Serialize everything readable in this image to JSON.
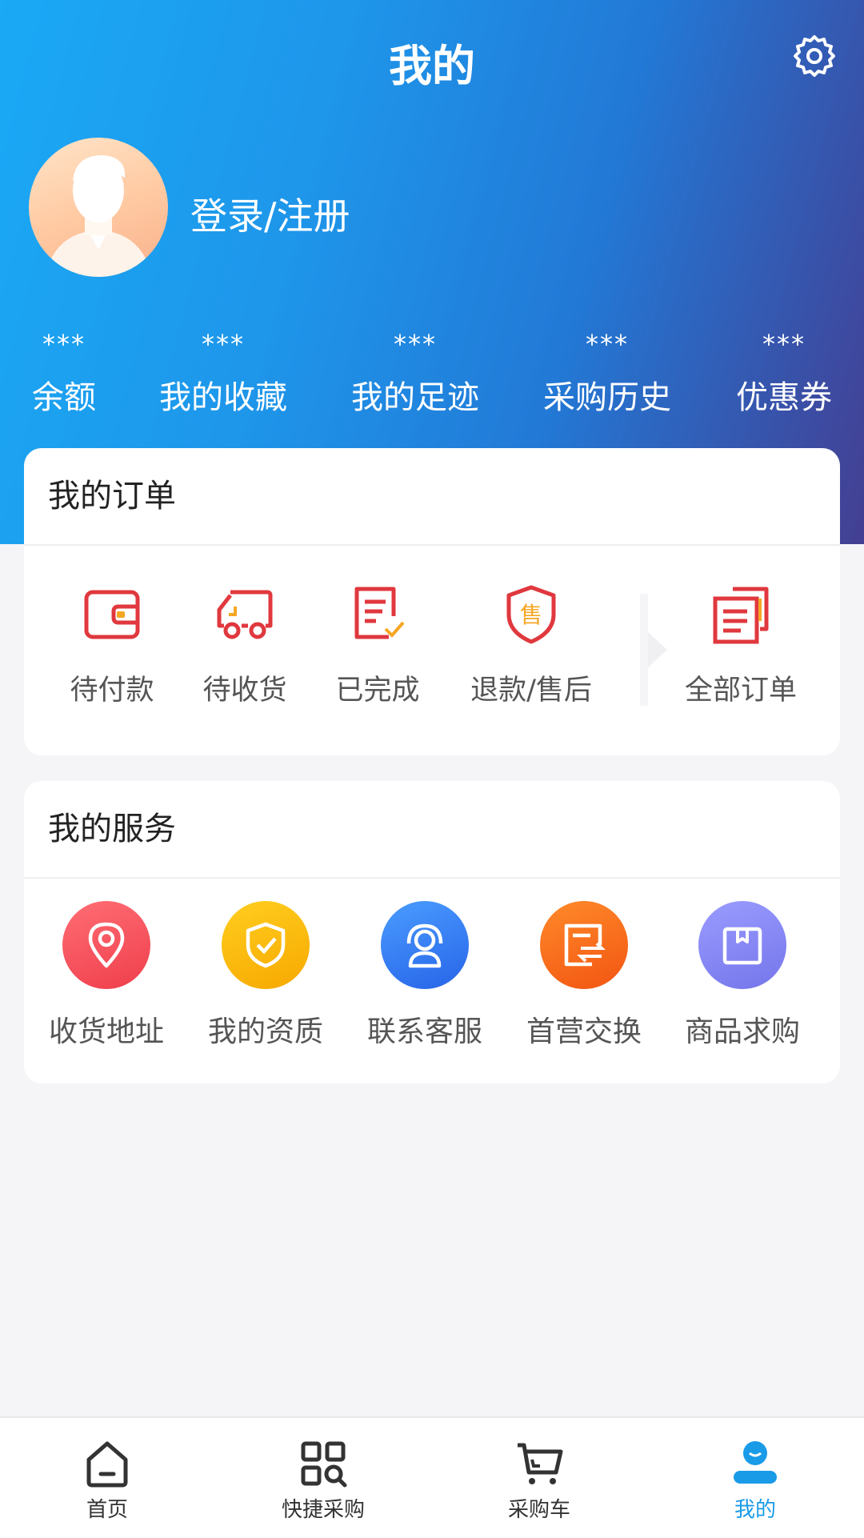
{
  "header": {
    "title": "我的",
    "settings_icon": "gear-icon"
  },
  "profile": {
    "login_label": "登录/注册",
    "avatar_icon": "default-avatar"
  },
  "stats": [
    {
      "value": "***",
      "label": "余额"
    },
    {
      "value": "***",
      "label": "我的收藏"
    },
    {
      "value": "***",
      "label": "我的足迹"
    },
    {
      "value": "***",
      "label": "采购历史"
    },
    {
      "value": "***",
      "label": "优惠券"
    }
  ],
  "orders": {
    "title": "我的订单",
    "items": [
      {
        "label": "待付款",
        "icon": "wallet-icon"
      },
      {
        "label": "待收货",
        "icon": "truck-icon"
      },
      {
        "label": "已完成",
        "icon": "document-check-icon"
      },
      {
        "label": "退款/售后",
        "icon": "shield-sale-icon"
      },
      {
        "label": "全部订单",
        "icon": "documents-icon"
      }
    ]
  },
  "services": {
    "title": "我的服务",
    "items": [
      {
        "label": "收货地址",
        "icon": "location-pin-icon",
        "color": "#f5545f"
      },
      {
        "label": "我的资质",
        "icon": "shield-check-icon",
        "color": "#f7b500"
      },
      {
        "label": "联系客服",
        "icon": "customer-service-icon",
        "color": "#2f7af2"
      },
      {
        "label": "首营交换",
        "icon": "exchange-icon",
        "color": "#fb6a17"
      },
      {
        "label": "商品求购",
        "icon": "box-icon",
        "color": "#7f80ef"
      }
    ]
  },
  "tabbar": {
    "items": [
      {
        "label": "首页",
        "icon": "home-icon"
      },
      {
        "label": "快捷采购",
        "icon": "qr-search-icon"
      },
      {
        "label": "采购车",
        "icon": "cart-icon"
      },
      {
        "label": "我的",
        "icon": "user-icon"
      }
    ],
    "active_index": 3,
    "active_color": "#1a9be8"
  },
  "colors": {
    "accent": "#1a9be8",
    "order_icon_red": "#e0383e",
    "order_icon_orange": "#f5a623"
  }
}
